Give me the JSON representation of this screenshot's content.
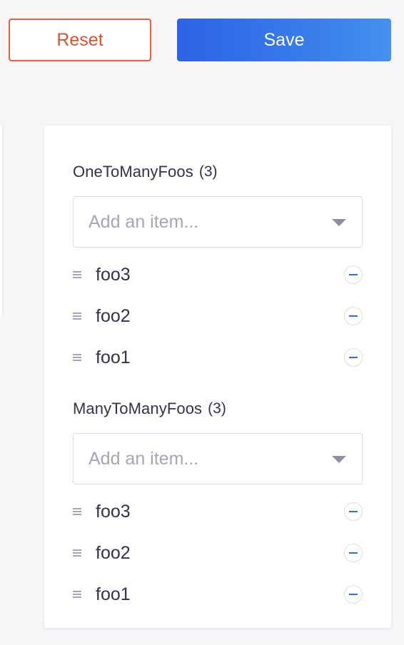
{
  "actions": {
    "reset_label": "Reset",
    "save_label": "Save"
  },
  "relations": [
    {
      "name": "OneToManyFoos",
      "count": "(3)",
      "placeholder": "Add an item...",
      "items": [
        "foo3",
        "foo2",
        "foo1"
      ]
    },
    {
      "name": "ManyToManyFoos",
      "count": "(3)",
      "placeholder": "Add an item...",
      "items": [
        "foo3",
        "foo2",
        "foo1"
      ]
    }
  ],
  "colors": {
    "primary": "#2f6bea",
    "danger": "#d9532d",
    "background": "#f6f6f9"
  }
}
